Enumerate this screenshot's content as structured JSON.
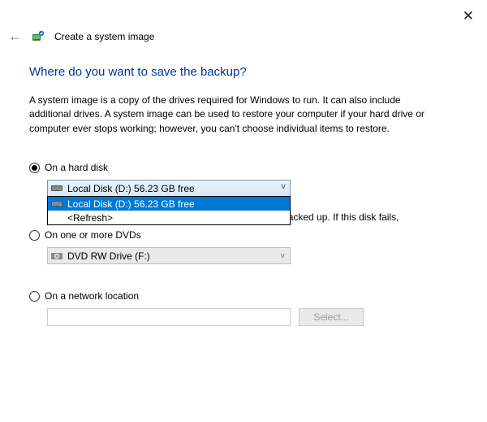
{
  "window": {
    "title": "Create a system image"
  },
  "page": {
    "heading": "Where do you want to save the backup?",
    "description": "A system image is a copy of the drives required for Windows to run. It can also include additional drives. A system image can be used to restore your computer if your hard drive or computer ever stops working; however, you can't choose individual items to restore."
  },
  "options": {
    "hard_disk": {
      "label": "On a hard disk",
      "selected_text": "Local Disk (D:)  56.23 GB free",
      "dropdown": {
        "item_selected": "Local Disk (D:)  56.23 GB free",
        "refresh": "<Refresh>"
      },
      "warning_partial": "eing backed up. If this disk fails,"
    },
    "dvd": {
      "label": "On one or more DVDs",
      "selected_text": "DVD RW Drive (F:)"
    },
    "network": {
      "label": "On a network location",
      "value": "",
      "select_button": "Select..."
    }
  }
}
